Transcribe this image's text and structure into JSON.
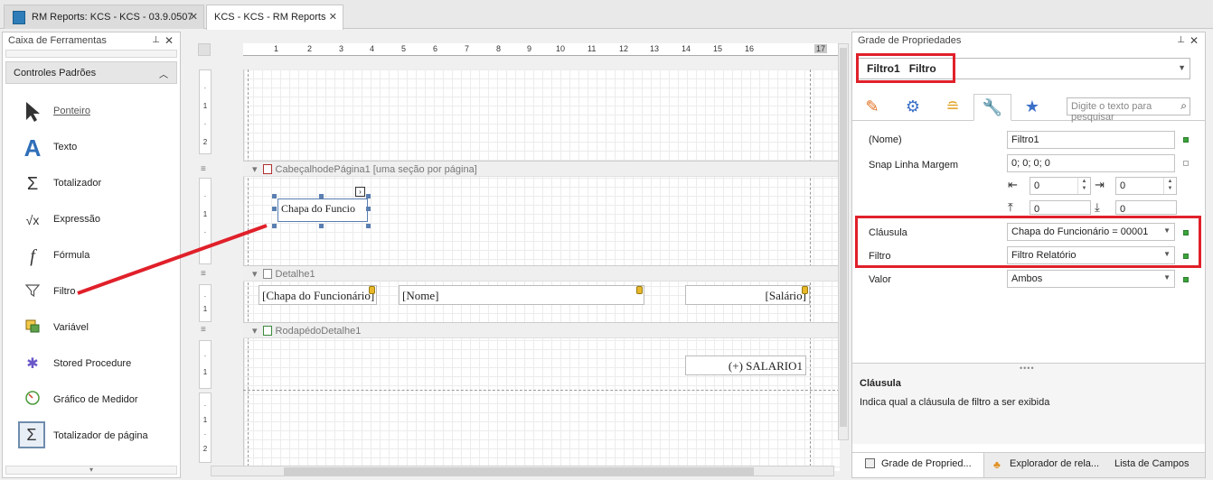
{
  "tabs": [
    {
      "label": "RM Reports: KCS - KCS - 03.9.0507",
      "close": "✕"
    },
    {
      "label": "KCS - KCS - RM Reports",
      "close": "✕"
    }
  ],
  "toolbox": {
    "title": "Caixa de Ferramentas",
    "group": "Controles Padrões",
    "items": [
      {
        "label": "Ponteiro",
        "icon": "pointer-icon"
      },
      {
        "label": "Texto",
        "icon": "text-icon"
      },
      {
        "label": "Totalizador",
        "icon": "sigma-icon"
      },
      {
        "label": "Expressão",
        "icon": "sqrt-icon"
      },
      {
        "label": "Fórmula",
        "icon": "function-icon"
      },
      {
        "label": "Filtro",
        "icon": "filter-icon"
      },
      {
        "label": "Variável",
        "icon": "variable-icon"
      },
      {
        "label": "Stored Procedure",
        "icon": "gears-icon"
      },
      {
        "label": "Gráfico de Medidor",
        "icon": "gauge-icon"
      },
      {
        "label": "Totalizador de página",
        "icon": "page-sum-icon"
      }
    ]
  },
  "designer": {
    "ruler_marks": [
      "1",
      "1",
      "2",
      "3",
      "4",
      "5",
      "6",
      "7",
      "8",
      "9",
      "10",
      "11",
      "12",
      "13",
      "14",
      "15",
      "16",
      "17"
    ],
    "bands": {
      "page_header": {
        "name": "CabeçalhodePágina1",
        "note": "[uma seção por página]"
      },
      "detail": {
        "name": "Detalhe1"
      },
      "detail_footer": {
        "name": "RodapédoDetalhe1"
      }
    },
    "fields": {
      "selected": "Chapa do Funcio",
      "chapa": "[Chapa do Funcionário]",
      "nome": "[Nome]",
      "salario": "[Salário]",
      "total": "(+) SALARIO1"
    },
    "vruler1": [
      "·",
      "1",
      "·",
      "2"
    ],
    "vruler2": [
      "·",
      "1",
      "·"
    ],
    "vruler3": [
      "·",
      "1"
    ],
    "vruler4": [
      "·",
      "1"
    ],
    "vruler5": [
      "·",
      "1",
      "·",
      "2"
    ]
  },
  "properties": {
    "title": "Grade de Propriedades",
    "object_name": "Filtro1",
    "object_type": "Filtro",
    "search_placeholder": "Digite o texto para pesquisar",
    "rows": {
      "nome": {
        "label": "(Nome)",
        "value": "Filtro1"
      },
      "snap": {
        "label": "Snap Linha Margem",
        "value": "0; 0; 0; 0"
      },
      "spin_values": [
        "0",
        "0",
        "0",
        "0"
      ],
      "clausula": {
        "label": "Cláusula",
        "value": "Chapa do Funcionário = 00001"
      },
      "filtro": {
        "label": "Filtro",
        "value": "Filtro Relatório"
      },
      "valor": {
        "label": "Valor",
        "value": "Ambos"
      }
    },
    "description": {
      "title": "Cláusula",
      "text": "Indica qual a cláusula de filtro a ser exibida"
    },
    "bottom_tabs": [
      "Grade de Propried...",
      "Explorador de rela...",
      "Lista de Campos"
    ]
  },
  "colors": {
    "highlight": "#e0202a",
    "status_green": "#3aa43a"
  }
}
